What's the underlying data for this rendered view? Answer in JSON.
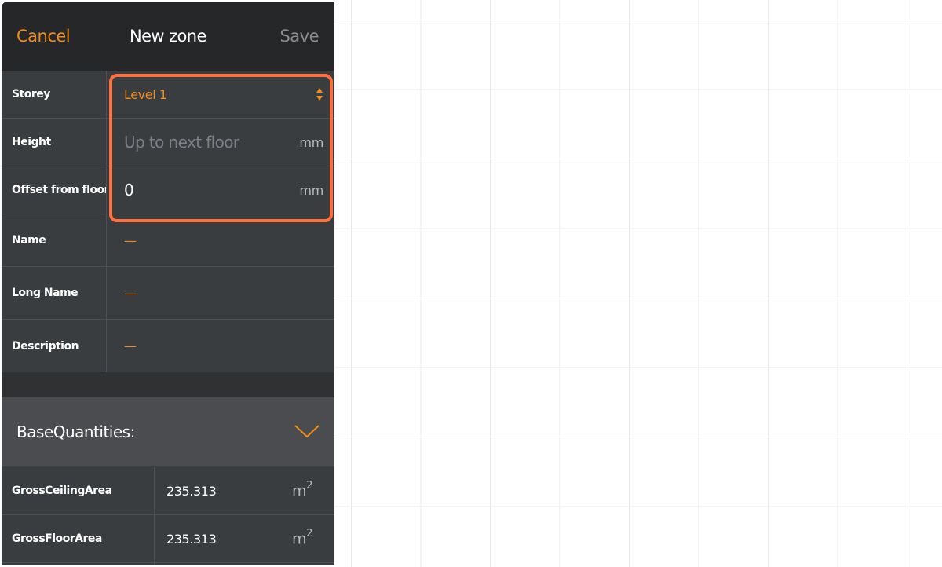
{
  "header": {
    "cancel_label": "Cancel",
    "title": "New zone",
    "save_label": "Save"
  },
  "colors": {
    "accent": "#f08c1a",
    "highlight": "#ff6f3c",
    "panel_bg": "#3a3d40",
    "header_bg": "#262728"
  },
  "fields": {
    "storey": {
      "label": "Storey",
      "value": "Level 1",
      "icon": "select-arrows-icon"
    },
    "height": {
      "label": "Height",
      "placeholder": "Up to next floor",
      "unit": "mm"
    },
    "offset": {
      "label": "Offset from floor",
      "value": "0",
      "unit": "mm"
    },
    "name": {
      "label": "Name",
      "value": "—"
    },
    "long_name": {
      "label": "Long Name",
      "value": "—"
    },
    "description": {
      "label": "Description",
      "value": "—"
    }
  },
  "base_quantities": {
    "title": "BaseQuantities:",
    "icon": "chevron-down-icon",
    "rows": [
      {
        "label": "GrossCeilingArea",
        "value": "235.313",
        "unit": "m",
        "unit_sup": "2"
      },
      {
        "label": "GrossFloorArea",
        "value": "235.313",
        "unit": "m",
        "unit_sup": "2"
      }
    ]
  }
}
